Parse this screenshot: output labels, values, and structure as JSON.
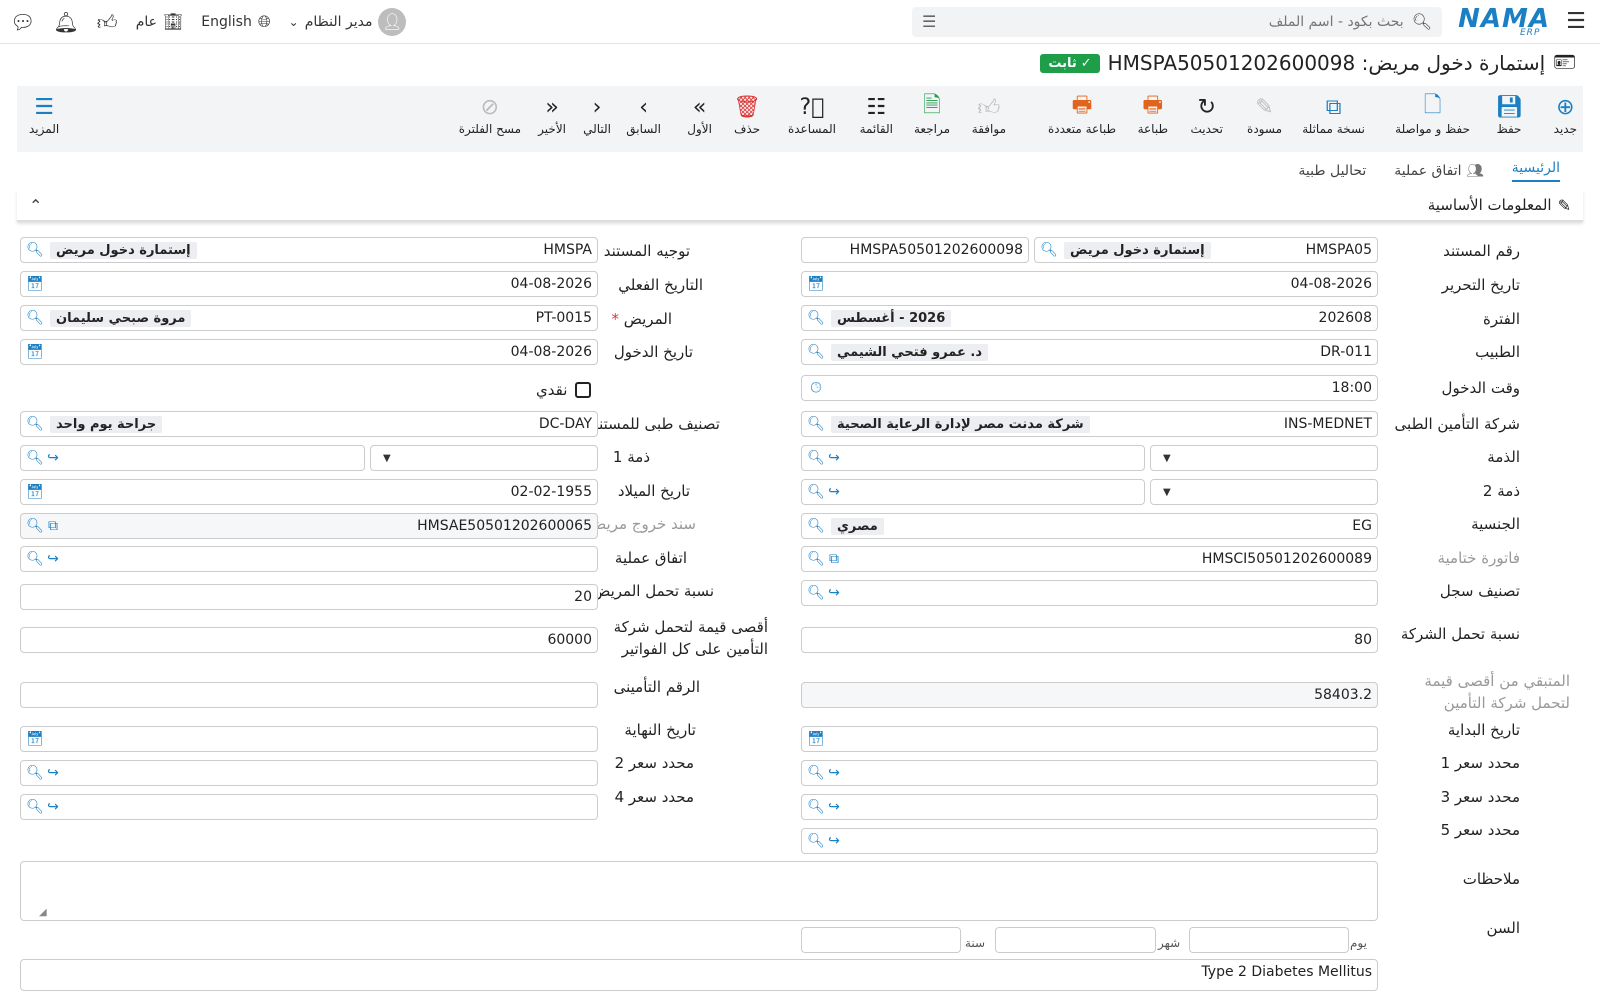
{
  "topbar": {
    "logo": "NAMA",
    "logo_sub": "ERP",
    "search_placeholder": "بحث بكود - اسم الملف",
    "org_label": "عام",
    "language_label": "English",
    "user_name": "مدير النظام"
  },
  "document": {
    "title": "إستمارة دخول مريض: HMSPA50501202600098",
    "status": "ثابت"
  },
  "toolbar": {
    "new": "جديد",
    "save": "حفظ",
    "save_continue": "حفظ و مواصلة",
    "duplicate": "نسخة مماثلة",
    "draft": "مسودة",
    "refresh": "تحديث",
    "print": "طباعة",
    "multi_print": "طباعة متعددة",
    "approve": "موافقة",
    "review": "مراجعة",
    "list": "القائمة",
    "help": "المساعدة",
    "delete": "حذف",
    "first": "الأول",
    "prev": "السابق",
    "next": "التالي",
    "last": "الأخير",
    "clear_filter": "مسح الفلترة",
    "more": "المزيد"
  },
  "tabs": {
    "main": "الرئيسية",
    "operation_agreement": "اتفاق عملية",
    "medical_tests": "تحاليل طبية"
  },
  "section": {
    "title": "المعلومات الأساسية"
  },
  "labels": {
    "doc_number": "رقم المستند",
    "doc_direction": "توجيه المستند",
    "edit_date": "تاريخ التحرير",
    "actual_date": "التاريخ الفعلي",
    "period": "الفترة",
    "patient": "المريض",
    "doctor": "الطبيب",
    "entry_date": "تاريخ الدخول",
    "entry_time": "وقت الدخول",
    "cash": "نقدي",
    "insurance_company": "شركة التأمين الطبى",
    "doc_medical_class": "تصنيف طبى للمستند",
    "subsidiary": "الذمة",
    "subsidiary1": "ذمة 1",
    "subsidiary2": "ذمة 2",
    "birth_date": "تاريخ الميلاد",
    "nationality": "الجنسية",
    "discharge_doc": "سند خروج مريض",
    "final_invoice": "فاتورة ختامية",
    "operation_agreement": "اتفاق عملية",
    "record_class": "تصنيف سجل",
    "patient_share": "نسبة تحمل المريض",
    "company_share": "نسبة تحمل الشركة",
    "max_company_value": "أقصى قيمة لتحمل شركة التأمين على كل الفواتير",
    "remaining_max": "المتبقي من أقصى قيمة لتحمل شركة التأمين",
    "insurance_number": "الرقم التأمينى",
    "start_date": "تاريخ البداية",
    "end_date": "تاريخ النهاية",
    "price_det1": "محدد سعر 1",
    "price_det2": "محدد سعر 2",
    "price_det3": "محدد سعر 3",
    "price_det4": "محدد سعر 4",
    "price_det5": "محدد سعر 5",
    "notes": "ملاحظات",
    "age": "السن",
    "day": "يوم",
    "month": "شهر",
    "year": "سنة"
  },
  "values": {
    "doc_number_code": "HMSPA05",
    "doc_number_desc": "إستمارة دخول مريض",
    "doc_number_full": "HMSPA50501202600098",
    "doc_direction_code": "HMSPA",
    "doc_direction_desc": "إستمارة دخول مريض",
    "edit_date": "04-08-2026",
    "actual_date": "04-08-2026",
    "period_code": "202608",
    "period_desc": "2026 - أغسطس",
    "patient_code": "PT-0015",
    "patient_desc": "مروة صبحي سليمان",
    "doctor_code": "DR-011",
    "doctor_desc": "د. عمرو فتحي الشيمي",
    "entry_date": "04-08-2026",
    "entry_time": "18:00",
    "insurance_code": "INS-MEDNET",
    "insurance_desc": "شركة مدنت مصر لإدارة الرعاية الصحية",
    "doc_class_code": "DC-DAY",
    "doc_class_desc": "جراحة يوم واحد",
    "birth_date": "02-02-1955",
    "nationality_code": "EG",
    "nationality_desc": "مصري",
    "discharge_doc": "HMSAE50501202600065",
    "final_invoice": "HMSCI50501202600089",
    "patient_share": "20",
    "company_share": "80",
    "max_company_value": "60000",
    "remaining_max": "58403.2",
    "diagnosis": "Type 2 Diabetes Mellitus"
  }
}
